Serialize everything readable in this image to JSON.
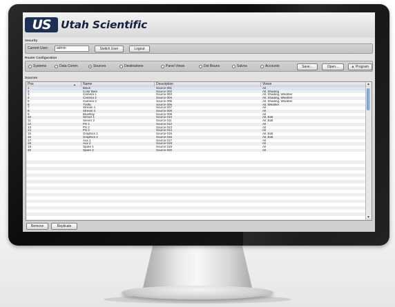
{
  "app": {
    "brand_mark": "US",
    "brand_name": "Utah Scientific"
  },
  "security": {
    "section_label": "Security",
    "current_user_label": "Current User:",
    "current_user_value": "admin",
    "switch_user_label": "Switch User",
    "logout_label": "Logout"
  },
  "router_configuration": {
    "section_label": "Router Configuration",
    "radios": [
      {
        "label": "Systems",
        "selected": false
      },
      {
        "label": "Data Comm",
        "selected": false
      },
      {
        "label": "Sources",
        "selected": true
      },
      {
        "label": "Destinations",
        "selected": false
      },
      {
        "label": "Panel Views",
        "selected": false
      },
      {
        "label": "Dst Bouns",
        "selected": false
      },
      {
        "label": "Salvos",
        "selected": false
      },
      {
        "label": "Accounts",
        "selected": false
      }
    ],
    "save_label": "Save...",
    "open_label": "Open...",
    "program_label": "Program",
    "program_icon": "program-arrow-icon"
  },
  "sources": {
    "section_label": "Sources",
    "columns": [
      "Pos",
      "Name",
      "Description",
      "Views"
    ],
    "rows": [
      [
        "1",
        "Black",
        "Source 001",
        "All"
      ],
      [
        "2",
        "Color Bars",
        "Source 002",
        "All, Shading"
      ],
      [
        "3",
        "Camera 1",
        "Source 003",
        "All, Shading, Weather"
      ],
      [
        "4",
        "Camera 2",
        "Source 004",
        "All, Shading, Weather"
      ],
      [
        "5",
        "Camera 3",
        "Source 005",
        "All, Shading, Weather"
      ],
      [
        "6",
        "Traffic",
        "Source 006",
        "All, Weather"
      ],
      [
        "7",
        "Stream 1",
        "Source 007",
        "All"
      ],
      [
        "8",
        "Stream 2",
        "Source 008",
        "All"
      ],
      [
        "9",
        "BlueRay",
        "Source 009",
        "All"
      ],
      [
        "10",
        "Server 1",
        "Source 010",
        "All, Edit"
      ],
      [
        "11",
        "Server 2",
        "Source 011",
        "All, Edit"
      ],
      [
        "12",
        "PS 1",
        "Source 012",
        "All"
      ],
      [
        "13",
        "PS 2",
        "Source 013",
        "All"
      ],
      [
        "14",
        "PS 3",
        "Source 014",
        "All"
      ],
      [
        "15",
        "Graphics 1",
        "Source 015",
        "All, Edit"
      ],
      [
        "16",
        "Graphics 2",
        "Source 016",
        "All, Edit"
      ],
      [
        "17",
        "Aux 1",
        "Source 017",
        "All"
      ],
      [
        "18",
        "Aux 2",
        "Source 018",
        "All"
      ],
      [
        "19",
        "Spare 1",
        "Source 019",
        "All"
      ],
      [
        "20",
        "Spare 2",
        "Source 020",
        "All"
      ]
    ],
    "remove_label": "Remove",
    "replicate_label": "Replicate"
  },
  "colors": {
    "brand": "#1e2f55",
    "program_arrow": "#2f8f2f",
    "selection": "#dbe6f4"
  }
}
